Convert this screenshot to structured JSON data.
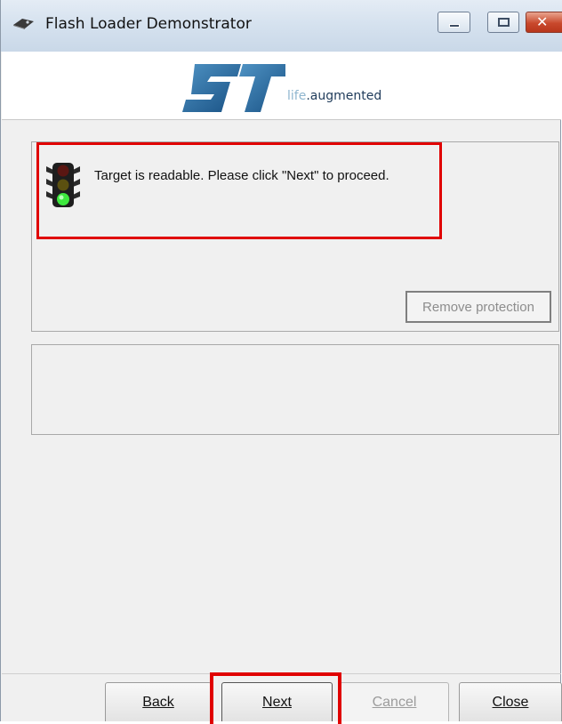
{
  "window": {
    "title": "Flash Loader Demonstrator",
    "controls": [
      "minimize",
      "maximize",
      "close"
    ]
  },
  "banner": {
    "logo": "st-logo",
    "tagline_prefix": "life",
    "tagline_suffix": ".augmented"
  },
  "status": {
    "icon": "traffic-light-green-icon",
    "message": "Target is readable. Please click \"Next\" to proceed."
  },
  "buttons": {
    "remove_protection": "Remove protection",
    "back": "Back",
    "next": "Next",
    "cancel": "Cancel",
    "close": "Close"
  },
  "colors": {
    "highlight": "#e00000",
    "light_green": "#3ee83e",
    "st_blue": "#1c5a8c"
  }
}
